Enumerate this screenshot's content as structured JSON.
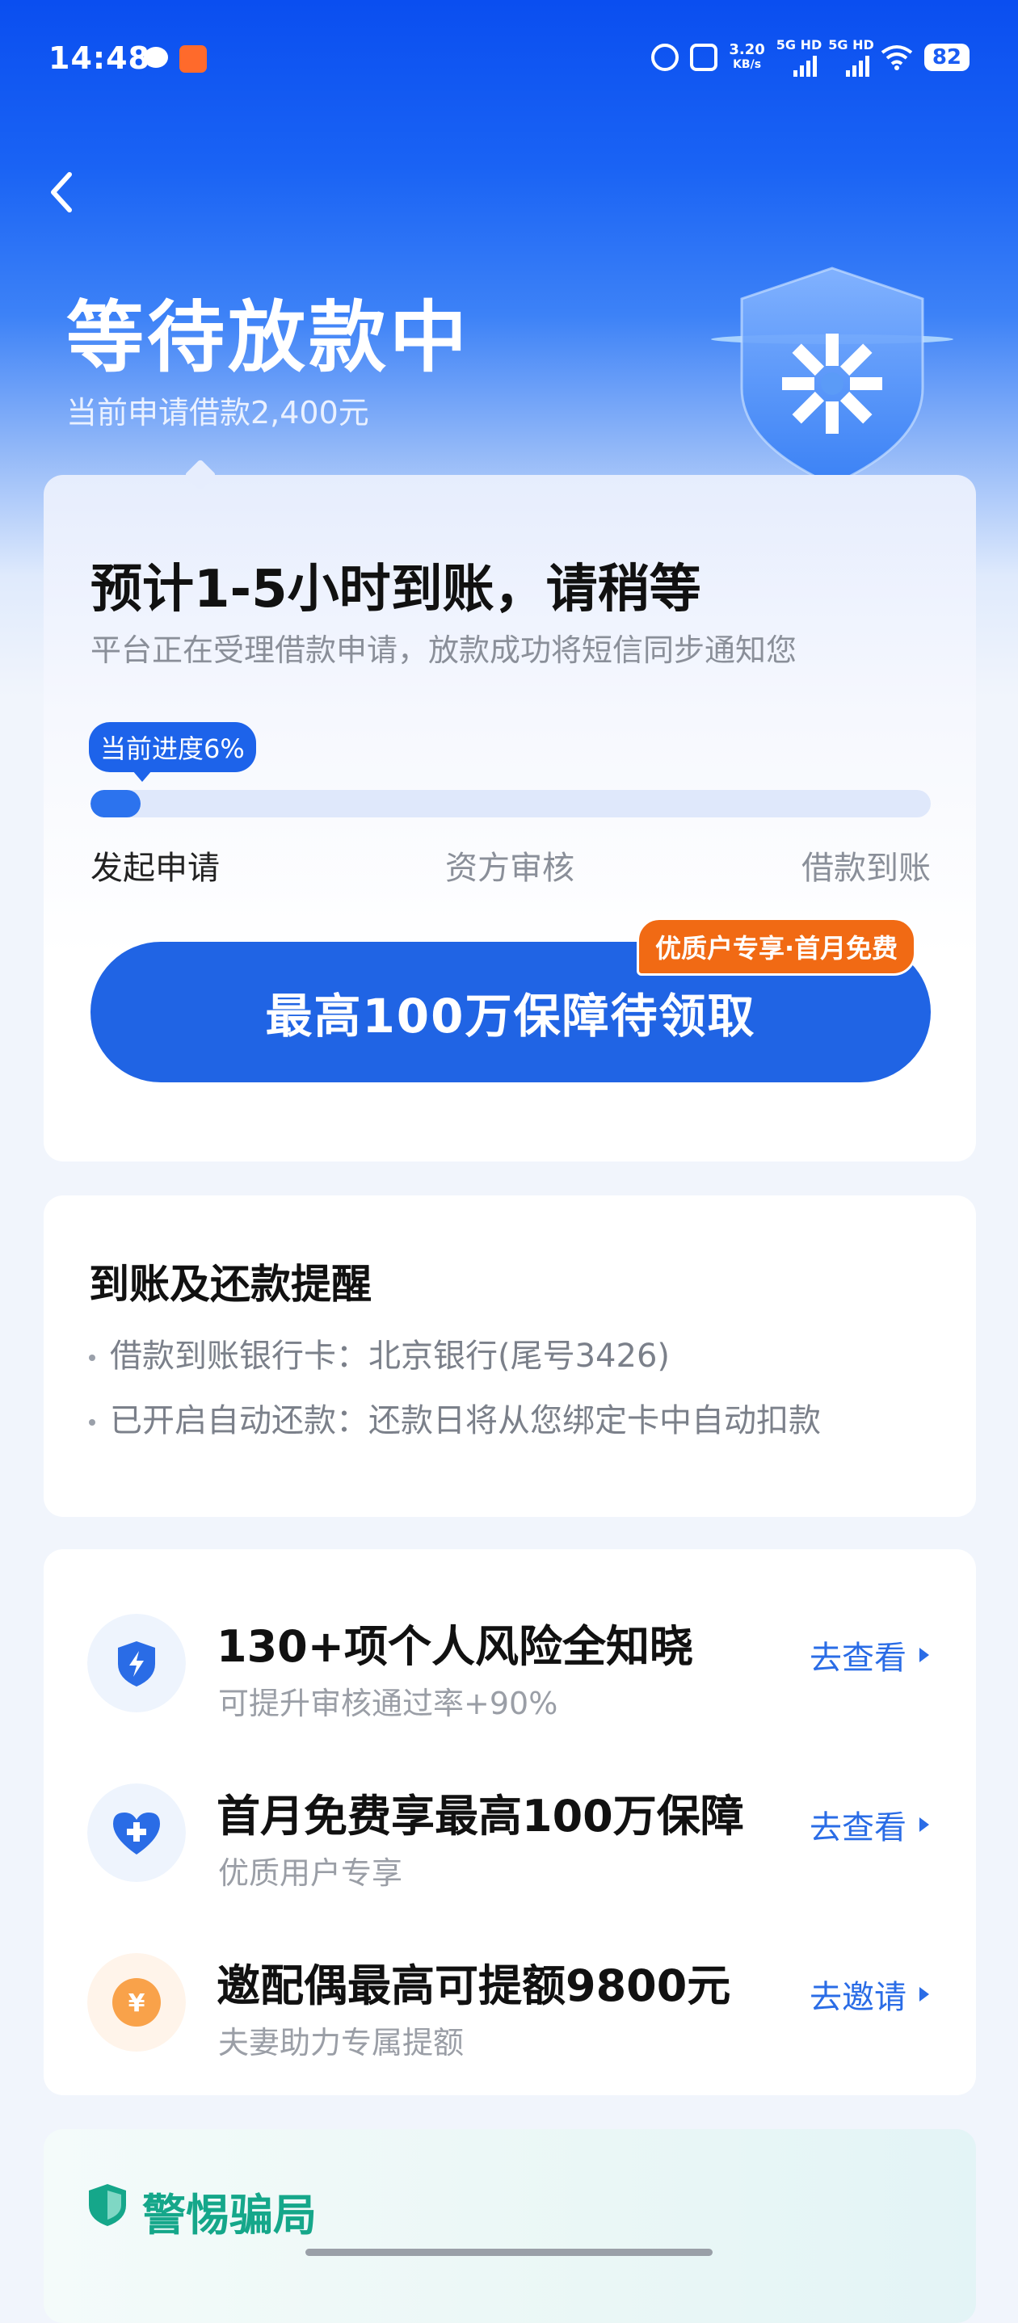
{
  "status_bar": {
    "time": "14:48",
    "net_speed": "3.20",
    "net_unit": "KB/s",
    "sig1": "5G HD",
    "sig2": "5G HD",
    "battery": "82"
  },
  "header": {
    "title": "等待放款中",
    "subtitle": "当前申请借款2,400元"
  },
  "progress_card": {
    "title": "预计1-5小时到账，请稍等",
    "subtitle": "平台正在受理借款申请，放款成功将短信同步通知您",
    "progress_label": "当前进度6%",
    "progress_percent": 6,
    "steps": [
      "发起申请",
      "资方审核",
      "借款到账"
    ],
    "cta_label": "最高100万保障待领取",
    "cta_badge": "优质户专享·首月免费"
  },
  "reminder_card": {
    "title": "到账及还款提醒",
    "lines": [
      "借款到账银行卡：北京银行(尾号3426)",
      "已开启自动还款：还款日将从您绑定卡中自动扣款"
    ]
  },
  "services": [
    {
      "icon": "shield-lightning-icon",
      "title": "130+项个人风险全知晓",
      "subtitle": "可提升审核通过率+90%",
      "link": "去查看"
    },
    {
      "icon": "heart-plus-icon",
      "title": "首月免费享最高100万保障",
      "subtitle": "优质用户专享",
      "link": "去查看"
    },
    {
      "icon": "yuan-coin-icon",
      "title": "邀配偶最高可提额9800元",
      "subtitle": "夫妻助力专属提额",
      "link": "去邀请"
    }
  ],
  "fraud_card": {
    "title": "警惕骗局"
  },
  "colors": {
    "primary": "#2064e4",
    "badge": "#f16a14",
    "fraud_green": "#15a78a"
  }
}
